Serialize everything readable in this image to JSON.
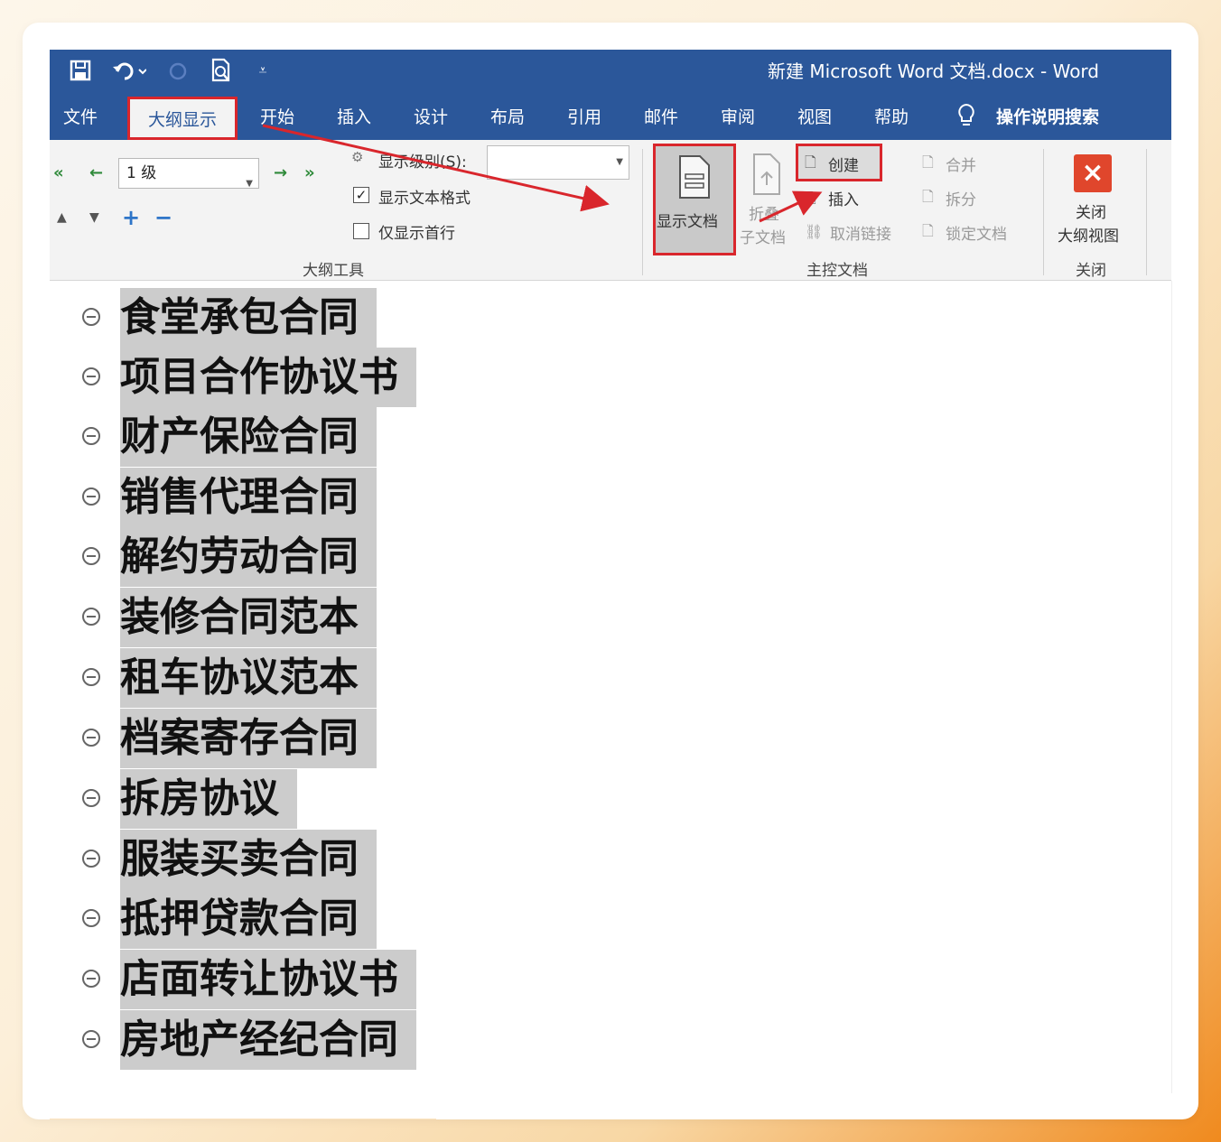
{
  "window": {
    "title": "新建 Microsoft Word 文档.docx  -  Word"
  },
  "tabs": [
    {
      "label": "文件",
      "active": false
    },
    {
      "label": "大纲显示",
      "active": true
    },
    {
      "label": "开始",
      "active": false
    },
    {
      "label": "插入",
      "active": false
    },
    {
      "label": "设计",
      "active": false
    },
    {
      "label": "布局",
      "active": false
    },
    {
      "label": "引用",
      "active": false
    },
    {
      "label": "邮件",
      "active": false
    },
    {
      "label": "审阅",
      "active": false
    },
    {
      "label": "视图",
      "active": false
    },
    {
      "label": "帮助",
      "active": false
    }
  ],
  "tell_me": "操作说明搜索",
  "ribbon": {
    "outline_tools": {
      "group_label": "大纲工具",
      "level_value": "1 级",
      "show_level_label": "显示级别(S):",
      "show_level_value": "",
      "show_text_format_label": "显示文本格式",
      "show_text_format_checked": true,
      "show_first_line_label": "仅显示首行",
      "show_first_line_checked": false
    },
    "master_document": {
      "group_label": "主控文档",
      "show_document": "显示文档",
      "collapse_sub_line1": "折叠",
      "collapse_sub_line2": "子文档",
      "create": "创建",
      "insert": "插入",
      "unlink": "取消链接",
      "merge": "合并",
      "split": "拆分",
      "lock_document": "锁定文档"
    },
    "close": {
      "group_label": "关闭",
      "close_line1": "关闭",
      "close_line2": "大纲视图"
    }
  },
  "outline_items": [
    "食堂承包合同",
    "项目合作协议书",
    "财产保险合同",
    "销售代理合同",
    "解约劳动合同",
    "装修合同范本",
    "租车协议范本",
    "档案寄存合同",
    "拆房协议",
    "服装买卖合同",
    "抵押贷款合同",
    "店面转让协议书",
    "房地产经纪合同"
  ],
  "colors": {
    "titlebar": "#2b579a",
    "highlight_box": "#d9262c",
    "ribbon_bg": "#f3f3f3",
    "selection": "#cccccc"
  }
}
